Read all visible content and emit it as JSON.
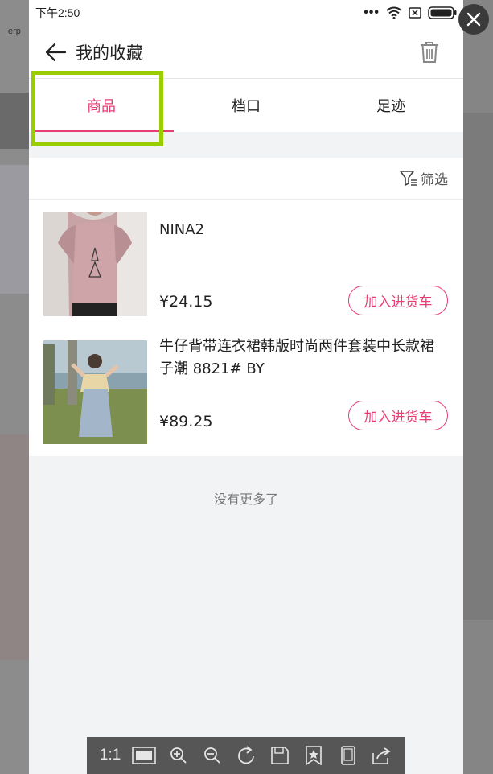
{
  "background": {
    "tab_label": "erp"
  },
  "status_bar": {
    "time": "下午2:50",
    "dots": "•••"
  },
  "header": {
    "title": "我的收藏"
  },
  "tabs": [
    {
      "label": "商品",
      "active": true
    },
    {
      "label": "档口",
      "active": false
    },
    {
      "label": "足迹",
      "active": false
    }
  ],
  "filter": {
    "label": "筛选"
  },
  "products": [
    {
      "title": "NINA2",
      "price": "¥24.15",
      "cart_label": "加入进货车"
    },
    {
      "title": "牛仔背带连衣裙韩版时尚两件套装中长款裙子潮 8821#  BY",
      "price": "¥89.25",
      "cart_label": "加入进货车"
    }
  ],
  "footer_note": "没有更多了",
  "viewer_toolbar": {
    "actual_size_label": "1:1"
  },
  "colors": {
    "accent": "#e83e74",
    "highlight": "#9acd00"
  }
}
